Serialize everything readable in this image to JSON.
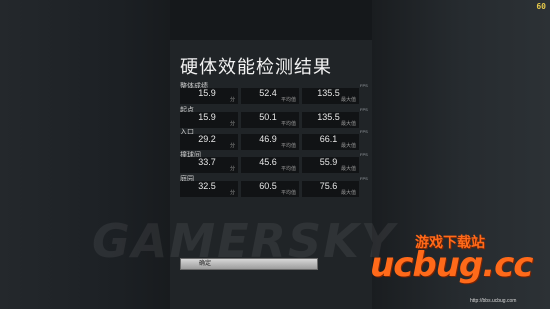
{
  "hud": {
    "fps": "60"
  },
  "dialog": {
    "title": "硬体效能检测结果",
    "confirm_label": "确定",
    "fps_tag": "FPS",
    "sub_labels": {
      "min": "分",
      "avg": "平均值",
      "max": "最大值"
    },
    "rows": [
      {
        "label": "整体成绩",
        "min": "15.9",
        "avg": "52.4",
        "max": "135.5"
      },
      {
        "label": "起点",
        "min": "15.9",
        "avg": "50.1",
        "max": "135.5"
      },
      {
        "label": "入口",
        "min": "29.2",
        "avg": "46.9",
        "max": "66.1"
      },
      {
        "label": "撞球间",
        "min": "33.7",
        "avg": "45.6",
        "max": "55.9"
      },
      {
        "label": "庭园",
        "min": "32.5",
        "avg": "60.5",
        "max": "75.6"
      }
    ]
  },
  "watermarks": {
    "gamersky": "GAMERSKY",
    "ucbug_cn": "游戏下载站",
    "ucbug": "ucbug.cc",
    "ucbug_url": "http://bbs.ucbug.com"
  }
}
